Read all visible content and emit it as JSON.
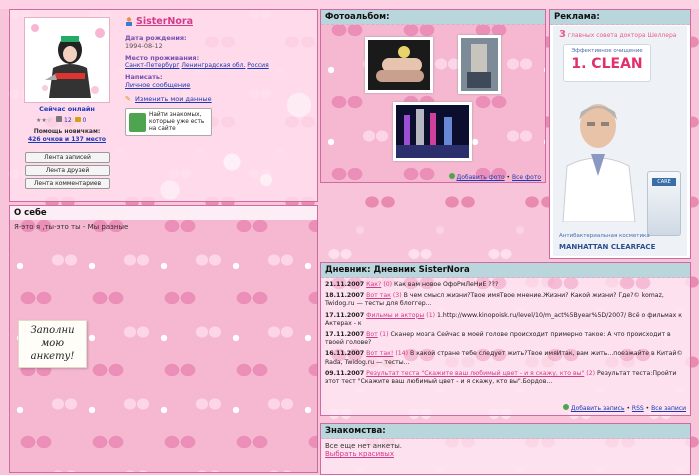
{
  "profile": {
    "name": "SisterNora",
    "status": "Сейчас онлайн",
    "rating_box_value": "12",
    "rating_box2_value": "0",
    "help_line1": "Помощь новичкам:",
    "help_line2": "426 очков и 137 место",
    "buttons": [
      "Лента записей",
      "Лента друзей",
      "Лента комментариев"
    ],
    "dob_label": "Дата рождения:",
    "dob_value": "1994-08-12",
    "loc_label": "Место проживания:",
    "loc_city": "Санкт-Петербург",
    "loc_region": "Ленинградская обл.",
    "loc_country": "Россия",
    "write_label": "Написать:",
    "write_link": "Личное сообщение",
    "edit_link": "Изменить мои данные",
    "find_text": "Найти знакомых, которые уже есть на сайте"
  },
  "photo": {
    "title": "Фотоальбом:",
    "add_label": "Добавить фото",
    "sep": "•",
    "all_label": "Все фото"
  },
  "ad": {
    "title": "Реклама:",
    "headline_num": "3",
    "headline_text": "главных совета доктора Шеллера",
    "clean_top": "Эффективное очищение",
    "clean_text": "1. CLEAN",
    "bottom_text": "Антибактериальная косметика",
    "brand": "MANHATTAN CLEARFACE"
  },
  "about": {
    "title": "О себе",
    "text": "Я-это я ,ты-это ты - Мы разные",
    "sticker": "Заполни мою анкету!"
  },
  "diary": {
    "title": "Дневник: Дневник SisterNora",
    "entries": [
      {
        "date": "21.11.2007",
        "cat": "Как?",
        "count": "(0)",
        "text": "Как вам новое ОфоРмЛеНиЕ ???"
      },
      {
        "date": "18.11.2007",
        "cat": "Вот так",
        "count": "(3)",
        "text": "В чем смысл жизни?Твое имяТвое мнение.Жизни? Какой жизни? Где?© komaz, Twidog.ru — тесты для блоггер..."
      },
      {
        "date": "17.11.2007",
        "cat": "Фильмы и акторы",
        "count": "(1)",
        "text": "1.http://www.kinopoisk.ru/level/10/m_act%5Byear%5D/2007/ Всё о фильмах к Актерах - к"
      },
      {
        "date": "17.11.2007",
        "cat": "Вот",
        "count": "(1)",
        "text": "Сканер мозга Сейчас в моей голове происходит примерно такое: А что происходит в твоей голове?"
      },
      {
        "date": "16.11.2007",
        "cat": "Вот так!",
        "count": "(14)",
        "text": "В какой стране тебе следует жить?Твое имяИтак, вам жить...поезжайте в Китай© Rada, Twidog.ru — тесты..."
      },
      {
        "date": "09.11.2007",
        "cat": "Результат теста \"Скажите ваш любимый цвет - и я скажу, кто вы\"",
        "count": "(2)",
        "text": "Результат теста:Пройти этот тест \"Скажите ваш любимый цвет - и я скажу, кто вы\".Бордов..."
      }
    ],
    "add_label": "Добавить запись",
    "rss_label": "RSS",
    "sep": "•",
    "all_label": "Все записи"
  },
  "friends": {
    "title": "Знакомства:",
    "text": "Все еще нет анкеты.",
    "link": "Выбрать красивых"
  }
}
